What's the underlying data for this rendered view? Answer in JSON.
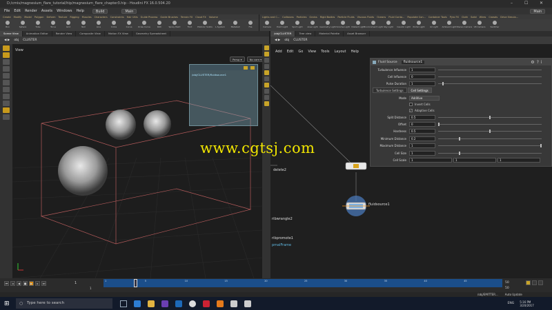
{
  "window": {
    "title": "D:/cmiv/magnesium_flare_tutorial/hip/magnesium_flare_chapter3.hip - Houdini FX 16.0.504.20",
    "controls": [
      "–",
      "☐",
      "✕"
    ]
  },
  "menu": {
    "items": [
      "File",
      "Edit",
      "Render",
      "Assets",
      "Windows",
      "Help"
    ],
    "build": "Build",
    "desktop": "Main",
    "desktop_right": "Main"
  },
  "shelf": {
    "tabs_left": [
      "Create",
      "Modify",
      "Model",
      "Polygon",
      "Deform",
      "Texture",
      "Rigging",
      "Muscles",
      "Characters",
      "Constraints",
      "Hair Utils",
      "Guide Process",
      "Guide Brushes",
      "Terrain FX",
      "Cloud FX",
      "Volume"
    ],
    "tabs_right": [
      "Lights and C...",
      "Collisions",
      "Particles",
      "Grains",
      "Rigid Bodies",
      "Particle Fluids",
      "Viscous Fluids",
      "Oceans",
      "Fluid Conta...",
      "Populate Con...",
      "Container Tools",
      "Pyro FX",
      "Cloth",
      "Solid",
      "Wires",
      "Crowds",
      "Drive Simula..."
    ],
    "icons_left": [
      "Box",
      "Sphere",
      "Tube",
      "Torus",
      "Grid",
      "Null",
      "Line",
      "Circle",
      "Curve",
      "Draw Curve",
      "Path",
      "Spray Paint",
      "Font",
      "Platonic Solids",
      "L-System",
      "Metaball",
      "File"
    ],
    "icons_right": [
      "Camera",
      "Point Light",
      "Spot Light",
      "Area Light",
      "Geometry Light",
      "Volume Light",
      "Distant Light",
      "Environment Light",
      "Sky Light",
      "Caustic Light",
      "Portal Light",
      "GI Light",
      "Ambient Light",
      "Stereo Camera",
      "VR Camera",
      "Switcher"
    ]
  },
  "pane_tabs_left": [
    "Scene View",
    "Animation Editor",
    "Render View",
    "Composite View",
    "Motion FX View",
    "Geometry Spreadsheet"
  ],
  "pane_tabs_right": [
    "/obj/CLUSTER",
    "Tree view",
    "Material Palette",
    "Asset Browser"
  ],
  "viewport": {
    "path": [
      "obj",
      "CLUSTER"
    ],
    "label": "View",
    "persp": "Persp ▾",
    "cam": "No cam ▾",
    "overlay_text": "/obj/CLUSTER/fluidsource1"
  },
  "network": {
    "path": [
      "obj",
      "CLUSTER"
    ],
    "menu": [
      "Add",
      "Edit",
      "Go",
      "View",
      "Tools",
      "Layout",
      "Help"
    ],
    "nodes": [
      "delete2",
      "fluidsource1",
      "ribwrangle2",
      "ribpromote1",
      "pmalFrame"
    ]
  },
  "parm": {
    "node_type": "Fluid Source",
    "node_name": "fluidsource1",
    "rows_top": [
      {
        "label": "Turbulence Influence",
        "value": "1"
      },
      {
        "label": "Cell Influence",
        "value": "0"
      },
      {
        "label": "Pulse Duration",
        "value": "1"
      }
    ],
    "subtabs": [
      "Turbulence Settings",
      "Cell Settings"
    ],
    "mode_label": "Mode",
    "mode_value": "Additive",
    "toggles": [
      {
        "label": "Invert Cells",
        "checked": false
      },
      {
        "label": "Adaptive Cells",
        "checked": true
      }
    ],
    "rows": [
      {
        "label": "Split Distance",
        "value": "0.5",
        "fill": 0.5
      },
      {
        "label": "Offset",
        "value": "0",
        "fill": 0.0
      },
      {
        "label": "Hardness",
        "value": "0.5",
        "fill": 0.5
      },
      {
        "label": "Minimum Distance",
        "value": "0.2",
        "fill": 0.2
      },
      {
        "label": "Maximum Distance",
        "value": "1",
        "fill": 1.0
      },
      {
        "label": "Cell Size",
        "value": "1",
        "fill": 0.2
      }
    ],
    "cell_scale": {
      "label": "Cell Scale",
      "values": [
        "1",
        "1",
        "1"
      ]
    }
  },
  "timeline": {
    "frame": "1",
    "start": "1",
    "end_top": "50",
    "end_bottom": "50",
    "ticks": [
      "1",
      "5",
      "10",
      "15",
      "20",
      "25",
      "30",
      "35",
      "40",
      "45"
    ]
  },
  "statusbar": {
    "path": "/obj/EMITTER...",
    "auto_update": "Auto Update"
  },
  "taskbar": {
    "search_placeholder": "Type here to search",
    "lang": "ENG",
    "time": "5:16 PM",
    "date": "3/20/2017"
  },
  "watermark": "www.cgtsj.com",
  "accent": "#d98b12",
  "timeline_color": "#1b4e8a"
}
